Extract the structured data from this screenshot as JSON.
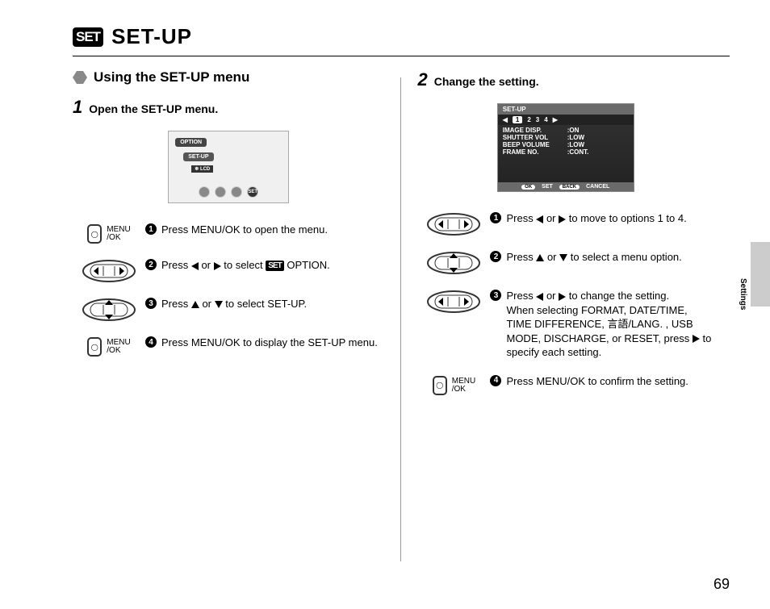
{
  "page_number": "69",
  "side_label": "Settings",
  "header": {
    "icon_text": "SET",
    "title": "SET-UP"
  },
  "section_title": "Using the SET-UP menu",
  "step1": {
    "num": "1",
    "label": "Open the SET-UP menu.",
    "lcd": {
      "option": "OPTION",
      "setup": "SET-UP",
      "sub": "LCD",
      "set_badge": "SET"
    },
    "instructions": [
      {
        "n": "1",
        "icon": "ok",
        "text": "Press MENU/OK to open the menu."
      },
      {
        "n": "2",
        "icon": "padh",
        "text_pre": "Press ",
        "text_mid": " or ",
        "text_post": " to select ",
        "suffix_icon": "SET",
        "text_end": " OPTION."
      },
      {
        "n": "3",
        "icon": "padv",
        "text_pre": "Press ",
        "text_mid": " or ",
        "text_post": " to select SET-UP."
      },
      {
        "n": "4",
        "icon": "ok",
        "text": "Press MENU/OK to display the SET-UP menu."
      }
    ],
    "menu_ok_label": "MENU\n/OK"
  },
  "step2": {
    "num": "2",
    "label": "Change the setting.",
    "lcd": {
      "title": "SET-UP",
      "tabs": [
        "1",
        "2",
        "3",
        "4"
      ],
      "rows": [
        {
          "k": "IMAGE DISP.",
          "v": ":ON"
        },
        {
          "k": "SHUTTER VOL",
          "v": ":LOW"
        },
        {
          "k": "BEEP VOLUME",
          "v": ":LOW"
        },
        {
          "k": "FRAME NO.",
          "v": ":CONT."
        }
      ],
      "footer_ok": "OK",
      "footer_set": "SET",
      "footer_back": "BACK",
      "footer_cancel": "CANCEL"
    },
    "instructions": [
      {
        "n": "1",
        "icon": "padh",
        "text_pre": "Press ",
        "text_mid": " or ",
        "text_post": " to move to options 1 to 4."
      },
      {
        "n": "2",
        "icon": "padv",
        "text_pre": "Press ",
        "text_mid": " or ",
        "text_post": " to select a menu option."
      },
      {
        "n": "3",
        "icon": "padh",
        "text_pre": "Press ",
        "text_mid": " or ",
        "text_post": " to change the setting.",
        "extra": "When selecting FORMAT, DATE/TIME, TIME DIFFERENCE, 言語/LANG. , USB MODE, DISCHARGE, or RESET, press ",
        "extra_post": " to specify each setting."
      },
      {
        "n": "4",
        "icon": "ok",
        "text": "Press MENU/OK to confirm the setting."
      }
    ],
    "menu_ok_label": "MENU\n/OK"
  }
}
